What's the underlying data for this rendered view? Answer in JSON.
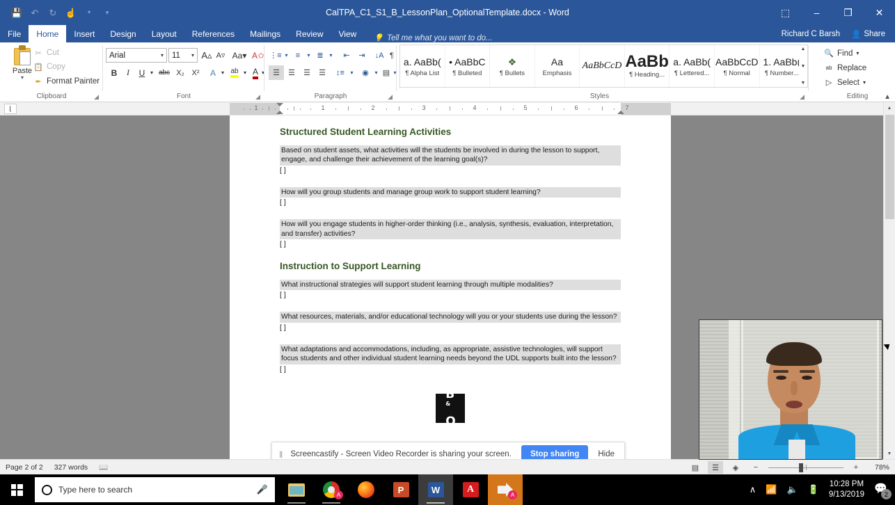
{
  "window": {
    "title": "CalTPA_C1_S1_B_LessonPlan_OptionalTemplate.docx - Word",
    "quick_access": [
      {
        "name": "save",
        "glyph": "💾"
      },
      {
        "name": "undo",
        "glyph": "↶"
      },
      {
        "name": "redo",
        "glyph": "↻"
      },
      {
        "name": "touch-mode",
        "glyph": "☝"
      },
      {
        "name": "customize",
        "glyph": "▾"
      }
    ],
    "controls": {
      "ribbon_display": "⬚",
      "minimize": "–",
      "restore": "❐",
      "close": "✕"
    }
  },
  "tabs": [
    {
      "label": "File",
      "active": false
    },
    {
      "label": "Home",
      "active": true
    },
    {
      "label": "Insert",
      "active": false
    },
    {
      "label": "Design",
      "active": false
    },
    {
      "label": "Layout",
      "active": false
    },
    {
      "label": "References",
      "active": false
    },
    {
      "label": "Mailings",
      "active": false
    },
    {
      "label": "Review",
      "active": false
    },
    {
      "label": "View",
      "active": false
    }
  ],
  "tell_me": "Tell me what you want to do...",
  "account": {
    "user": "Richard C Barsh",
    "share_label": "Share"
  },
  "ribbon": {
    "groups": [
      {
        "label": "Clipboard"
      },
      {
        "label": "Font"
      },
      {
        "label": "Paragraph"
      },
      {
        "label": "Styles"
      },
      {
        "label": "Editing"
      }
    ],
    "clipboard": {
      "paste_label": "Paste",
      "cut_label": "Cut",
      "copy_label": "Copy",
      "format_painter_label": "Format Painter"
    },
    "font": {
      "family": "Arial",
      "size": "11",
      "grow_label": "A",
      "shrink_label": "A",
      "change_case_label": "Aa",
      "clear_format_label": "A",
      "bold_label": "B",
      "italic_label": "I",
      "underline_label": "U",
      "strikethrough_label": "abc",
      "subscript_label": "X₂",
      "superscript_label": "X²",
      "text_effects_label": "A",
      "highlight_label": "ab",
      "font_color_label": "A"
    },
    "styles": [
      {
        "preview": "a. AaBb(",
        "name": "¶ Alpha List"
      },
      {
        "preview": "• AaBbC",
        "name": "¶ Bulleted"
      },
      {
        "preview": "❖",
        "name": "¶ Bullets"
      },
      {
        "preview": "Aa",
        "name": "Emphasis"
      },
      {
        "preview": "AaBbCcD",
        "name": ""
      },
      {
        "preview": "AaBb",
        "name": "¶ Heading..."
      },
      {
        "preview": "a. AaBb(",
        "name": "¶ Lettered..."
      },
      {
        "preview": "AaBbCcD",
        "name": "¶ Normal"
      },
      {
        "preview": "1. AaBb(",
        "name": "¶ Number..."
      }
    ],
    "editing": {
      "find_label": "Find",
      "replace_label": "Replace",
      "select_label": "Select"
    }
  },
  "ruler": {
    "numbers": [
      "1",
      "1",
      "2",
      "3",
      "4",
      "5",
      "6",
      "7"
    ]
  },
  "document": {
    "sections": [
      {
        "heading": "Structured Student Learning Activities",
        "items": [
          {
            "prompt": "Based on student assets, what activities will the students be involved in during the lesson to support, engage, and challenge their achievement of the learning goal(s)?",
            "answer": "[ ]"
          },
          {
            "prompt": "How will you group students and manage group work to support student learning?",
            "answer": "[ ]"
          },
          {
            "prompt": "How will you engage students in higher-order thinking (i.e., analysis, synthesis, evaluation, interpretation, and transfer) activities?",
            "answer": "[ ]"
          }
        ]
      },
      {
        "heading": "Instruction to Support Learning",
        "items": [
          {
            "prompt": "What instructional strategies will support student learning through multiple modalities?",
            "answer": "[ ]"
          },
          {
            "prompt": "What resources, materials, and/or educational technology will you or your students use during the lesson?",
            "answer": "[ ]"
          },
          {
            "prompt": "What adaptations and accommodations, including, as appropriate, assistive technologies, will support focus students and other individual student learning needs beyond the UDL supports built into the lesson?",
            "answer": "[ ]"
          }
        ]
      }
    ],
    "logo": {
      "line1": "B",
      "sup": "&",
      "line2": "O"
    }
  },
  "screencast_notice": {
    "pause_glyph": "‖",
    "message": "Screencastify - Screen Video Recorder is sharing your screen.",
    "stop_label": "Stop sharing",
    "hide_label": "Hide"
  },
  "status_bar": {
    "page": "Page 2 of 2",
    "words": "327 words",
    "proofing_icon": "proofing-errors-icon",
    "views": [
      {
        "name": "read-mode",
        "glyph": "▤",
        "active": false
      },
      {
        "name": "print-layout",
        "glyph": "☰",
        "active": true
      },
      {
        "name": "web-layout",
        "glyph": "◈",
        "active": false
      }
    ],
    "zoom_out": "−",
    "zoom_in": "+",
    "zoom_level": "78%"
  },
  "taskbar": {
    "search_placeholder": "Type here to search",
    "apps": [
      {
        "name": "file-explorer",
        "icon": "folder-icon",
        "active": false,
        "badge": ""
      },
      {
        "name": "google-chrome",
        "icon": "chrome-icon",
        "active": false,
        "badge": "A"
      },
      {
        "name": "mozilla-firefox",
        "icon": "firefox-icon",
        "active": false,
        "badge": ""
      },
      {
        "name": "powerpoint",
        "icon": "powerpoint-icon",
        "active": false,
        "badge": ""
      },
      {
        "name": "word",
        "icon": "word-icon",
        "active": true,
        "badge": ""
      },
      {
        "name": "adobe-acrobat",
        "icon": "acrobat-icon",
        "active": false,
        "badge": ""
      },
      {
        "name": "screencastify-recorder",
        "icon": "record-icon",
        "active": false,
        "badge": "A"
      }
    ],
    "tray": {
      "show_hidden": "∧",
      "network": "network-icon",
      "volume": "volume-icon",
      "battery": "battery-icon",
      "time": "10:28 PM",
      "date": "9/13/2019",
      "notification_count": "2"
    }
  },
  "colors": {
    "word_blue": "#2b579a",
    "heading_green": "#375623",
    "prompt_gray": "#dedede",
    "stop_blue": "#4285f4",
    "canvas_gray": "#868686"
  }
}
